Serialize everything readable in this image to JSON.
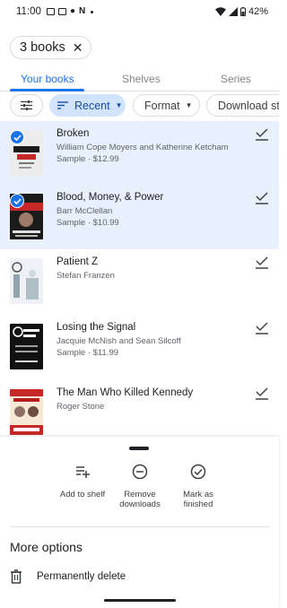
{
  "status_bar": {
    "time": "11:00",
    "battery": "42%"
  },
  "selection": {
    "count_label": "3 books",
    "close_icon": "close-icon"
  },
  "tabs": [
    {
      "label": "Your books",
      "active": true
    },
    {
      "label": "Shelves",
      "active": false
    },
    {
      "label": "Series",
      "active": false
    }
  ],
  "filters": [
    {
      "label": "",
      "icon": "tune-icon"
    },
    {
      "label": "Recent",
      "icon": "sort-icon",
      "selected": true
    },
    {
      "label": "Format"
    },
    {
      "label": "Download sta"
    }
  ],
  "books": [
    {
      "title": "Broken",
      "author": "William Cope Moyers and Katherine Ketcham",
      "price": "Sample · $12.99",
      "selected": true,
      "cover_color": "#e8e8e8"
    },
    {
      "title": "Blood, Money, & Power",
      "author": "Barr McClellan",
      "price": "Sample · $10.99",
      "selected": true,
      "cover_color": "#b71c1c"
    },
    {
      "title": "Patient Z",
      "author": "Stefan Franzen",
      "price": "",
      "selected": false,
      "cover_color": "#dfe6ee"
    },
    {
      "title": "Losing the Signal",
      "author": "Jacquie McNish and Sean Silcoff",
      "price": "Sample · $11.99",
      "selected": false,
      "cover_color": "#111111"
    },
    {
      "title": "The Man Who Killed Kennedy",
      "author": "Roger Stone",
      "price": "",
      "selected": false,
      "cover_color": "#c62828"
    }
  ],
  "sheet": {
    "actions": [
      {
        "label": "Add to shelf",
        "icon": "playlist-add-icon"
      },
      {
        "label": "Remove downloads",
        "icon": "remove-circle-icon"
      },
      {
        "label": "Mark as finished",
        "icon": "check-circle-icon"
      }
    ],
    "more_title": "More options",
    "delete_label": "Permanently delete"
  },
  "colors": {
    "accent": "#1a73e8",
    "selected_row": "#e8f0fe",
    "selected_chip": "#d2e3fc"
  }
}
